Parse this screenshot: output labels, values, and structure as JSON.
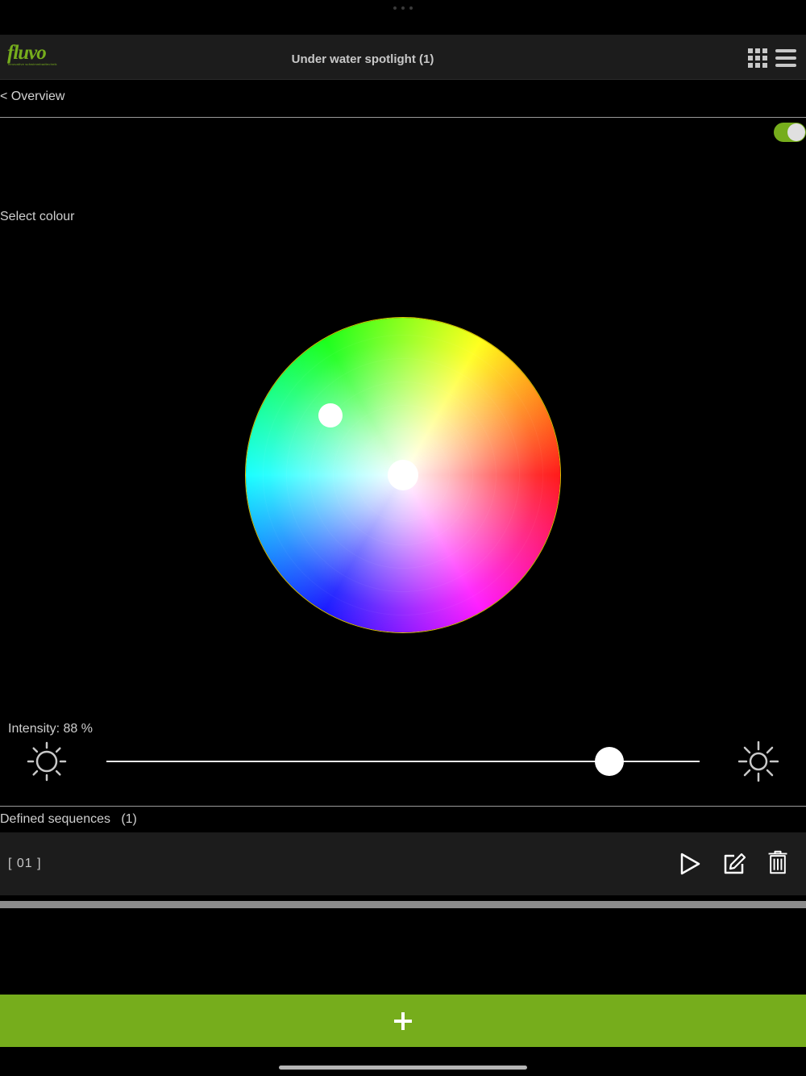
{
  "app": {
    "logo_text": "fluvo",
    "logo_tagline": "innovative schwimmbadtechnik",
    "window_title": "Under water spotlight (1)"
  },
  "nav": {
    "back_label": "< Overview"
  },
  "power": {
    "on": true
  },
  "colour": {
    "label": "Select colour"
  },
  "intensity": {
    "label": "Intensity: 88 %",
    "value_percent": 88
  },
  "sequences": {
    "label": "Defined sequences   (1)",
    "items": [
      {
        "name": "[ 01 ]"
      }
    ]
  },
  "actions": {
    "add_symbol": "+"
  },
  "colors": {
    "accent": "#76ad1c",
    "background": "#000000",
    "panel": "#1c1c1c"
  },
  "icons": {
    "grid": "grid-icon",
    "menu": "menu-icon",
    "play": "play-icon",
    "edit": "edit-icon",
    "delete": "trash-icon",
    "sun": "sun-icon"
  }
}
